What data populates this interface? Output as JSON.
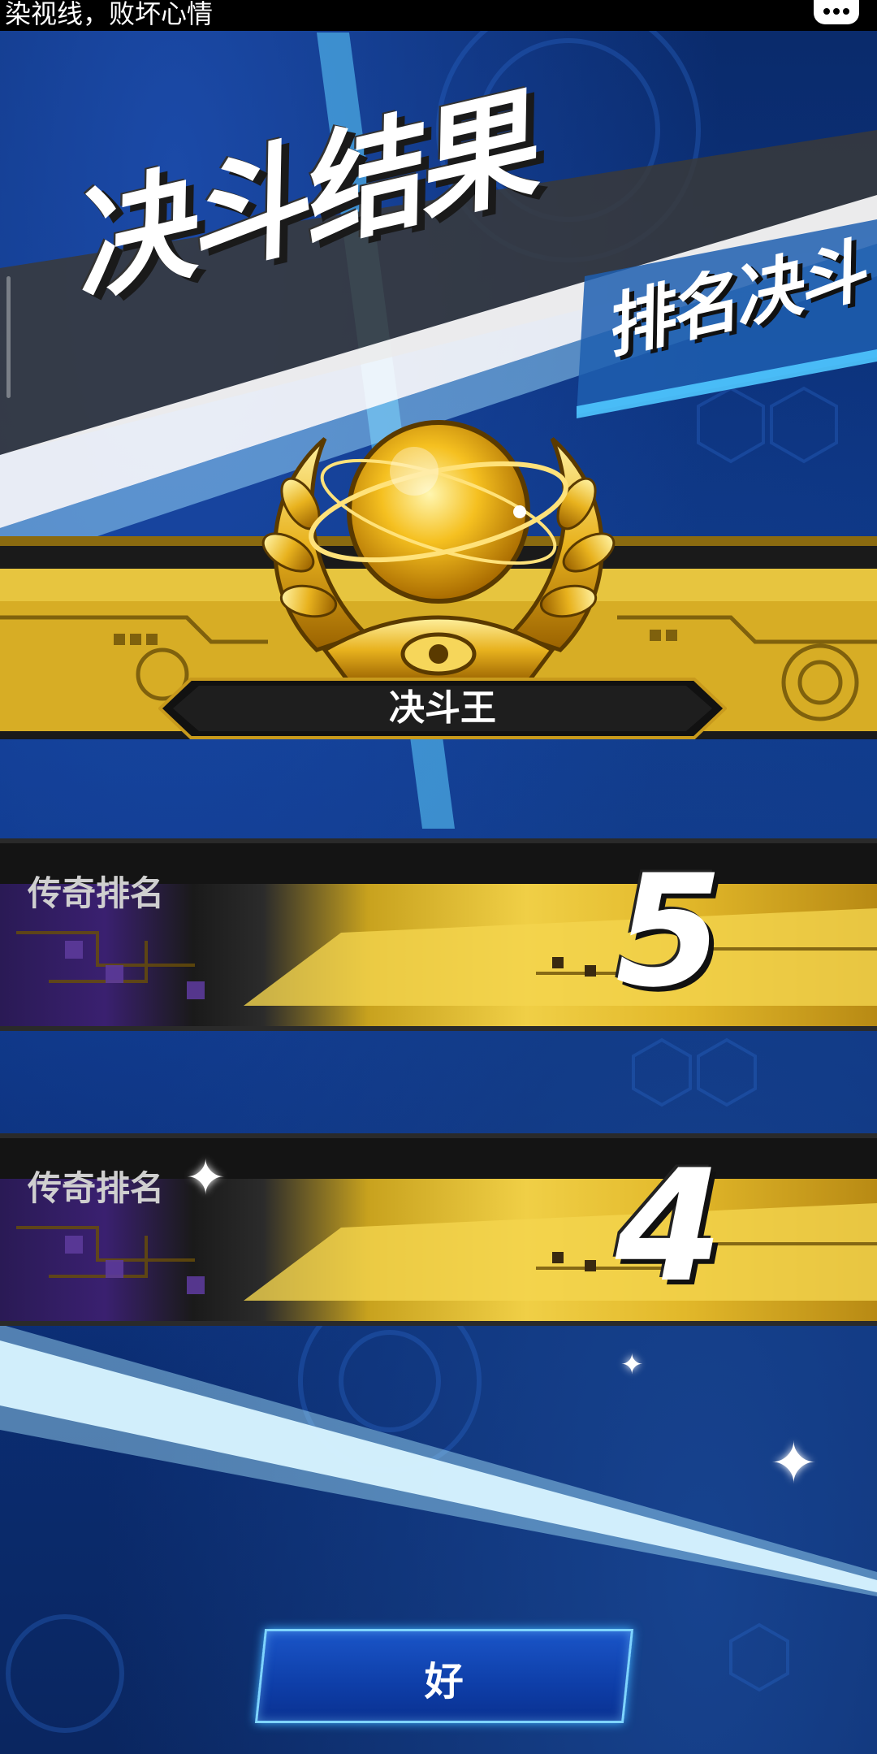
{
  "notification": {
    "text": "染视线，败坏心情",
    "icon": "chat-bubble-icon"
  },
  "header": {
    "title": "决斗结果",
    "subtitle": "排名决斗"
  },
  "emblem": {
    "icon": "golden-orb-laurel-emblem",
    "rank_title": "决斗王"
  },
  "rank_changes": [
    {
      "label": "传奇排名",
      "value": "5"
    },
    {
      "label": "传奇排名",
      "value": "4"
    }
  ],
  "actions": {
    "ok_label": "好"
  },
  "colors": {
    "background": "#0b2c6e",
    "gold": "#f0cf46",
    "button": "#1a55c8",
    "button_border": "#7fd4ff"
  }
}
